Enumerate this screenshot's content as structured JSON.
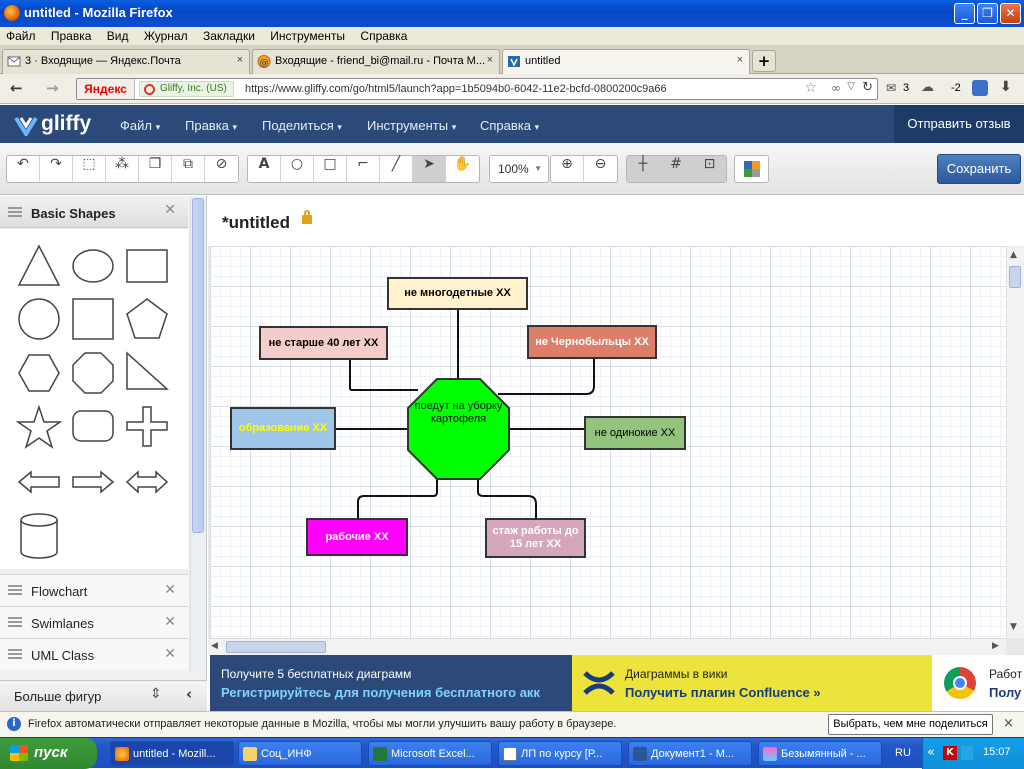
{
  "window": {
    "title": "untitled - Mozilla Firefox"
  },
  "menubar": {
    "items": [
      "Файл",
      "Правка",
      "Вид",
      "Журнал",
      "Закладки",
      "Инструменты",
      "Справка"
    ]
  },
  "tabs": [
    {
      "label": "3 · Входящие — Яндекс.Почта",
      "icon": "mail-icon",
      "close": "×"
    },
    {
      "label": "Входящие - friend_bi@mail.ru - Почта М...",
      "icon": "mail-icon",
      "close": "×"
    },
    {
      "label": "untitled",
      "icon": "gliffy-icon",
      "close": "×"
    }
  ],
  "newtab": "+",
  "nav": {
    "yandex": "Яндекс",
    "identity": "Gliffy, Inc. (US)",
    "url": "https://www.gliffy.com/go/html5/launch?app=1b5094b0-6042-11e2-bcfd-0800200c9a66",
    "mail_count": "3",
    "weather": "-2"
  },
  "gliffy": {
    "logo": "gliffy",
    "menu": [
      "Файл",
      "Правка",
      "Поделиться",
      "Инструменты",
      "Справка"
    ],
    "feedback": "Отправить отзыв"
  },
  "toolbar": {
    "zoom": "100%",
    "save": "Сохранить"
  },
  "leftpanel": {
    "title": "Basic Shapes",
    "libraries": [
      "Flowchart",
      "Swimlanes",
      "UML Class"
    ],
    "more": "Больше фигур"
  },
  "document": {
    "title": "*untitled"
  },
  "diagram": {
    "center": "поедут на уборку картофеля",
    "nodes": [
      {
        "id": "n1",
        "label": "не многодетные ХХ"
      },
      {
        "id": "n2",
        "label": "не старше 40 лет ХХ"
      },
      {
        "id": "n3",
        "label": "не Чернобыльцы ХХ"
      },
      {
        "id": "n4",
        "label": "образование ХХ"
      },
      {
        "id": "n5",
        "label": "не одинокие ХХ"
      },
      {
        "id": "n6",
        "label": "рабочие ХХ"
      },
      {
        "id": "n7",
        "label": "стаж работы до 15 лет ХХ"
      }
    ]
  },
  "ad": {
    "a1_line1": "Получите 5 бесплатных диаграмм",
    "a1_line2": "Регистрируйтесь для получения бесплатного акк",
    "a2_line1": "Диаграммы в вики",
    "a2_line2": "Получить плагин Confluence »",
    "a3_line1": "Работ",
    "a3_line2": "Полу"
  },
  "notification": {
    "message": "Firefox автоматически отправляет некоторые данные в Mozilla, чтобы мы могли улучшить вашу работу в браузере.",
    "button": "Выбрать, чем мне поделиться",
    "close": "×"
  },
  "taskbar": {
    "start": "пуск",
    "tasks": [
      "untitled - Mozill...",
      "Соц_ИНФ",
      "Microsoft Excel...",
      "ЛП по курсу [Р...",
      "Документ1 - М...",
      "Безымянный - ..."
    ],
    "lang": "RU",
    "clock": "15:07"
  }
}
